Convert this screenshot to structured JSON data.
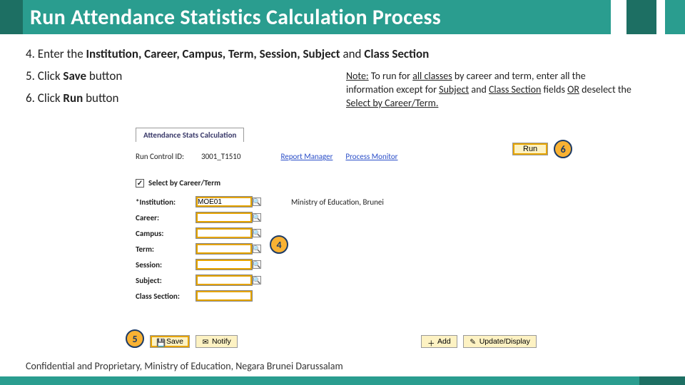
{
  "header": {
    "title": "Run Attendance Statistics Calculation Process"
  },
  "steps": {
    "s4_prefix": "Enter the ",
    "s4_bold": "Institution, Career, Campus, Term, Session, Subject",
    "s4_mid": " and ",
    "s4_bold2": "Class Section",
    "s5_prefix": "Click ",
    "s5_bold": "Save",
    "s5_suffix": " button",
    "s6_prefix": "Click ",
    "s6_bold": "Run",
    "s6_suffix": " button"
  },
  "note": {
    "lead": "Note:",
    "t1": " To run for ",
    "u1": "all classes",
    "t2": " by career and term, enter all the information except for ",
    "u2": "Subject",
    "t3": " and ",
    "u3": "Class Section",
    "t4": " fields ",
    "u4": "OR",
    "t5": " deselect the ",
    "u5": "Select by Career/Term.",
    "t6": ""
  },
  "app": {
    "tab": "Attendance Stats Calculation",
    "runctrl_label": "Run Control ID:",
    "runctrl_value": "3001_T1510",
    "link_reportmgr": "Report Manager",
    "link_procmon": "Process Monitor",
    "run_btn": "Run",
    "selectby_label": "Select by Career/Term",
    "checkbox_mark": "✓",
    "fields": {
      "institution_label": "*Institution:",
      "institution_value": "MOE01",
      "institution_desc": "Ministry of Education, Brunei",
      "career_label": "Career:",
      "campus_label": "Campus:",
      "term_label": "Term:",
      "session_label": "Session:",
      "subject_label": "Subject:",
      "classsec_label": "Class Section:"
    },
    "lookup_glyph": "🔍",
    "save_btn": "Save",
    "notify_btn": "Notify",
    "add_btn": "Add",
    "update_btn": "Update/Display",
    "save_icon": "💾",
    "notify_icon": "✉",
    "add_icon": "＋",
    "update_icon": "✎"
  },
  "callouts": {
    "c4": "4",
    "c5": "5",
    "c6": "6"
  },
  "footer": {
    "text": "Confidential and Proprietary, Ministry of Education, Negara Brunei Darussalam"
  }
}
